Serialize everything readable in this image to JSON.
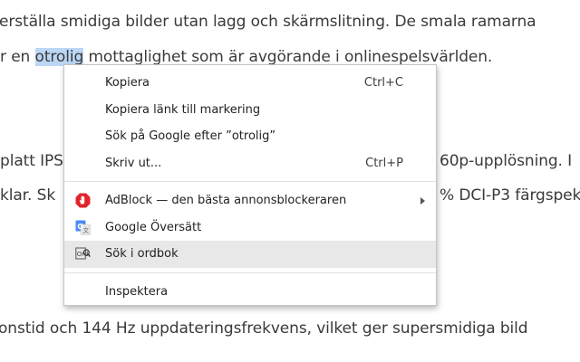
{
  "article": {
    "line1": "erställa smidiga bilder utan lagg och skärmslitning. De smala ramarna",
    "line2_before": "r en ",
    "line2_highlight": "otrolig",
    "line2_after": " mottaglighet som är avgörande i onlinespelsvärlden.",
    "line3_left": "platt IPS",
    "line3_right": "60p-upplösning. I",
    "line4_left": "klar. Sk",
    "line4_right": "% DCI-P3 färgspek",
    "line5": "onstid och 144 Hz uppdateringsfrekvens, vilket ger supersmidiga bild"
  },
  "context_menu": {
    "copy": "Kopiera",
    "copy_shortcut": "Ctrl+C",
    "copy_link": "Kopiera länk till markering",
    "search_google": "Sök på Google efter ”otrolig”",
    "print": "Skriv ut...",
    "print_shortcut": "Ctrl+P",
    "adblock": "AdBlock — den bästa annonsblockeraren",
    "google_translate": "Google Översätt",
    "dictionary": "Sök i ordbok",
    "inspect": "Inspektera"
  },
  "icons": {
    "adblock": "adblock-stop-hand-icon",
    "translate": "google-translate-icon",
    "dictionary": "dictionary-icon"
  },
  "colors": {
    "selection": "#bcd7f5",
    "adblock_red": "#e3232b",
    "translate_blue": "#4a8af4",
    "hover": "#e8e8e8"
  }
}
